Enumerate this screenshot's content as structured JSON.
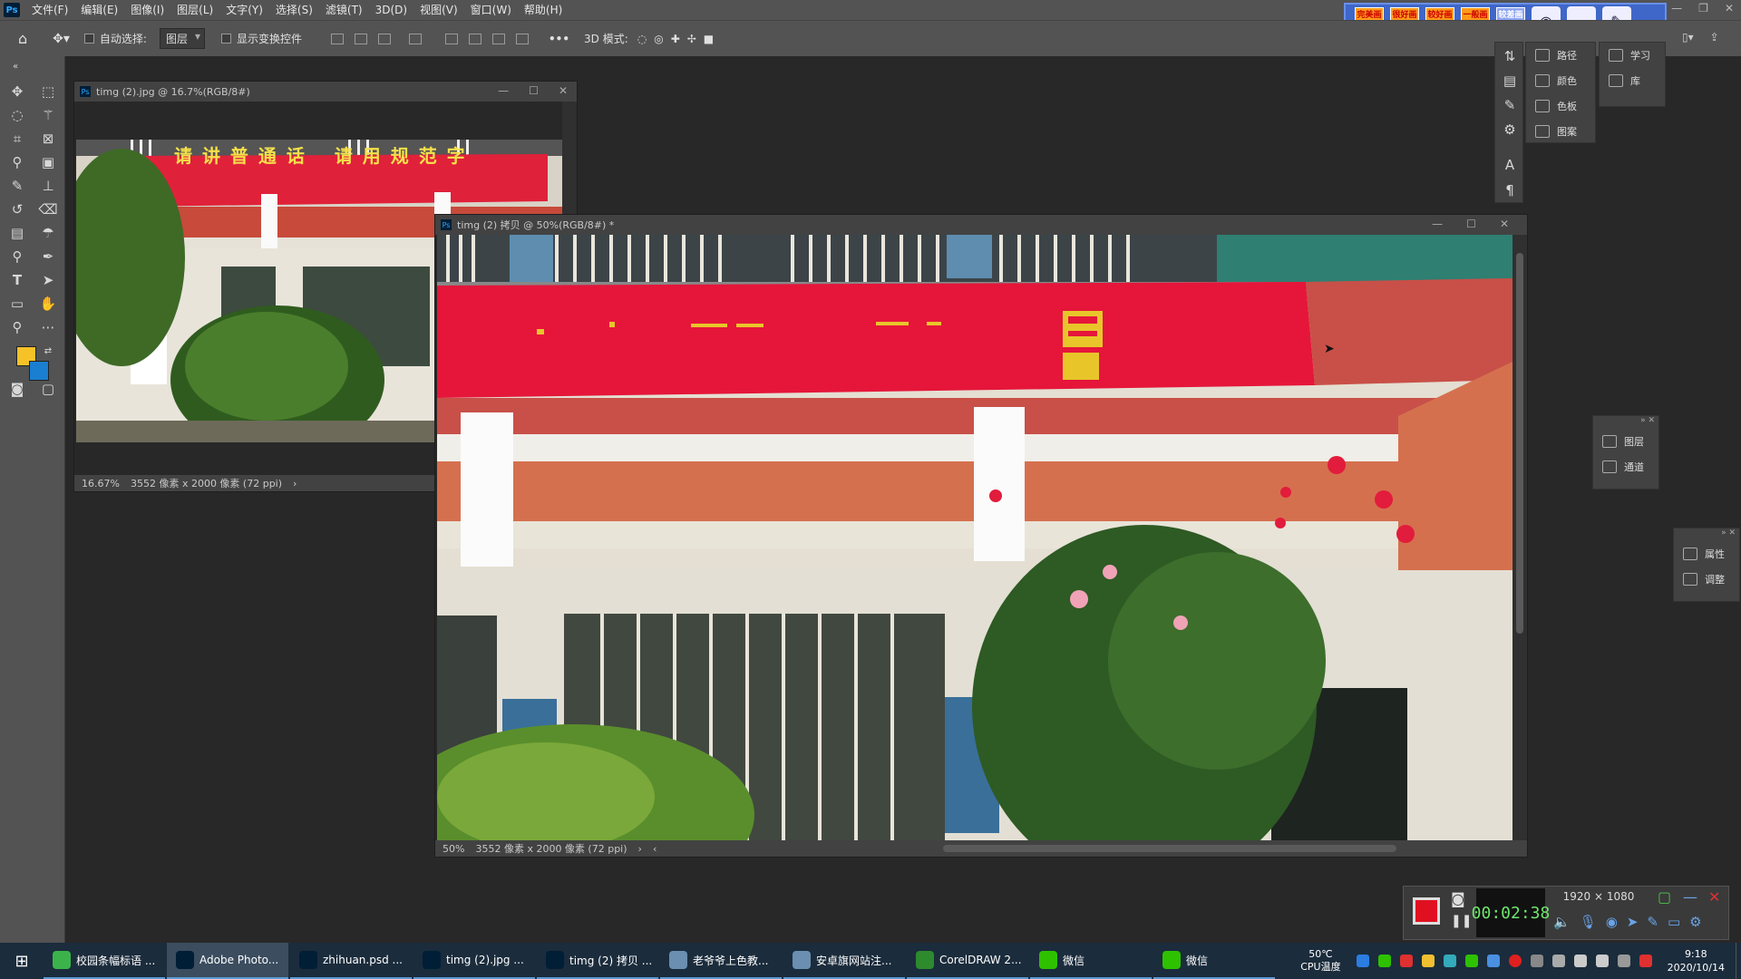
{
  "menubar": {
    "logo": "Ps",
    "items": [
      "文件(F)",
      "编辑(E)",
      "图像(I)",
      "图层(L)",
      "文字(Y)",
      "选择(S)",
      "滤镜(T)",
      "3D(D)",
      "视图(V)",
      "窗口(W)",
      "帮助(H)"
    ]
  },
  "options": {
    "auto_select_label": "自动选择:",
    "layer_select_value": "图层",
    "show_transform_label": "显示变换控件",
    "three_d_mode_label": "3D 模式:",
    "more": "•••"
  },
  "capture_widget": {
    "quality_buttons": [
      "完美画质",
      "很好画质",
      "较好画质",
      "一般画质",
      "较差画质"
    ]
  },
  "doc1": {
    "title": "timg (2).jpg @ 16.7%(RGB/8#)",
    "zoom": "16.67%",
    "info": "3552 像素 x 2000 像素 (72 ppi)",
    "banner_text": "请 讲 普 通 话　 请 用 规 范 字"
  },
  "doc2": {
    "title": "timg (2) 拷贝 @ 50%(RGB/8#) *",
    "zoom": "50%",
    "info": "3552 像素 x 2000 像素 (72 ppi)"
  },
  "panels": {
    "group1": [
      "路径",
      "颜色",
      "色板",
      "图案"
    ],
    "group2": [
      "学习",
      "库"
    ],
    "layers_group": [
      "图层",
      "通道"
    ],
    "props_group": [
      "属性",
      "调整"
    ]
  },
  "recorder": {
    "time": "00:02:38",
    "resolution": "1920 × 1080"
  },
  "taskbar": {
    "items": [
      {
        "label": "校园条幅标语 ...",
        "color": "#3bb34a"
      },
      {
        "label": "Adobe Photo...",
        "color": "#001e36"
      },
      {
        "label": "zhihuan.psd ...",
        "color": "#001e36"
      },
      {
        "label": "timg (2).jpg ...",
        "color": "#001e36"
      },
      {
        "label": "timg (2) 拷贝 ...",
        "color": "#001e36"
      },
      {
        "label": "老爷爷上色教...",
        "color": "#6a8fb0"
      },
      {
        "label": "安卓旗网站注...",
        "color": "#6a8fb0"
      },
      {
        "label": "CorelDRAW 2...",
        "color": "#2d8a2d"
      },
      {
        "label": "微信",
        "color": "#2dc100"
      },
      {
        "label": "微信",
        "color": "#2dc100"
      }
    ],
    "cpu_temp": "50℃",
    "cpu_label": "CPU温度",
    "time": "9:18",
    "date": "2020/10/14"
  },
  "colors": {
    "foreground": "#f5c227",
    "background": "#1a7fd0",
    "accent": "#5b9bd5"
  }
}
